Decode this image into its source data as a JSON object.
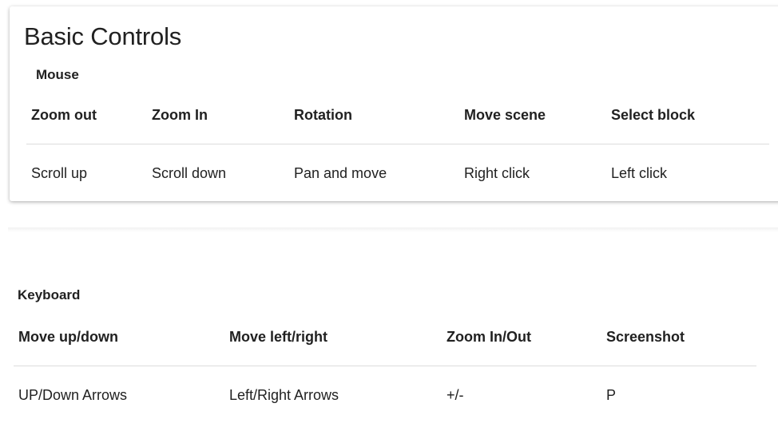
{
  "title": "Basic Controls",
  "mouse": {
    "label": "Mouse",
    "headers": [
      "Zoom out",
      "Zoom In",
      "Rotation",
      "Move scene",
      "Select block"
    ],
    "values": [
      "Scroll up",
      "Scroll down",
      "Pan and move",
      "Right click",
      "Left click"
    ]
  },
  "keyboard": {
    "label": "Keyboard",
    "headers": [
      "Move up/down",
      "Move left/right",
      "Zoom In/Out",
      "Screenshot"
    ],
    "values": [
      "UP/Down Arrows",
      "Left/Right Arrows",
      "+/-",
      "P"
    ]
  }
}
